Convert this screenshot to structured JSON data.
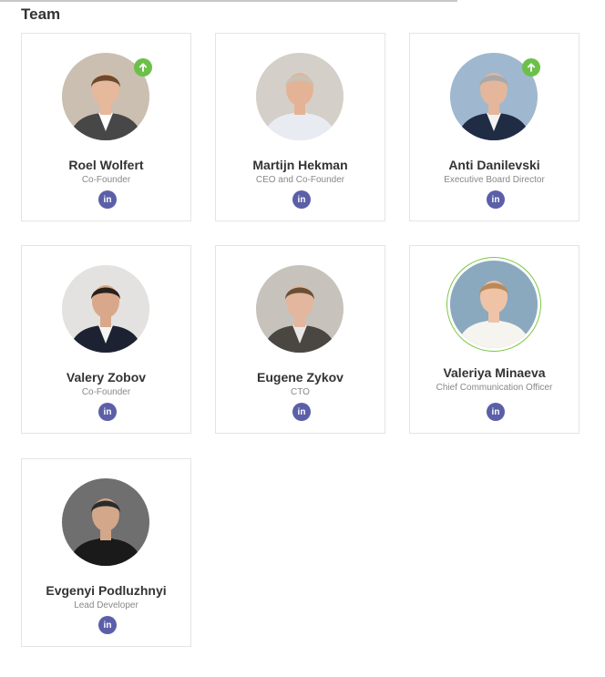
{
  "section": {
    "title": "Team"
  },
  "members": [
    {
      "name": "Roel Wolfert",
      "role": "Co-Founder",
      "badge": true,
      "featured": false,
      "bg": "#cbbfb2",
      "shirt": "#ffffff",
      "jacket": "#474747",
      "hair": "#6b4a30",
      "skin": "#e6b89c"
    },
    {
      "name": "Martijn Hekman",
      "role": "CEO and Co-Founder",
      "badge": false,
      "featured": false,
      "bg": "#d4d0c9",
      "shirt": "#e8ecf2",
      "jacket": "#e8ecf2",
      "hair": "#c9c2b5",
      "skin": "#e4b396"
    },
    {
      "name": "Anti Danilevski",
      "role": "Executive Board Director",
      "badge": true,
      "featured": false,
      "bg": "#9fb8cf",
      "shirt": "#f2f2f2",
      "jacket": "#1f2c44",
      "hair": "#a8a8a8",
      "skin": "#e4b69c"
    },
    {
      "name": "Valery Zobov",
      "role": "Co-Founder",
      "badge": false,
      "featured": false,
      "bg": "#e4e2e0",
      "shirt": "#f4f4f4",
      "jacket": "#1d2233",
      "hair": "#2a211c",
      "skin": "#d9a88a"
    },
    {
      "name": "Eugene Zykov",
      "role": "CTO",
      "badge": false,
      "featured": false,
      "bg": "#c7c3bc",
      "shirt": "#e8e8e8",
      "jacket": "#4a4743",
      "hair": "#6a4f35",
      "skin": "#e2b79e"
    },
    {
      "name": "Valeriya Minaeva",
      "role": "Chief Communication Officer",
      "badge": false,
      "featured": true,
      "bg": "#8aa9bf",
      "shirt": "#f6f4ef",
      "jacket": "#f6f4ef",
      "hair": "#b88a5a",
      "skin": "#efc3a6"
    },
    {
      "name": "Evgenyi Podluzhnyi",
      "role": "Lead Developer",
      "badge": false,
      "featured": false,
      "bg": "#6f6f6f",
      "shirt": "#1a1a1a",
      "jacket": "#1a1a1a",
      "hair": "#2b2b2b",
      "skin": "#d2a78a"
    }
  ],
  "social": {
    "linkedin_label": "in",
    "linkedin_color": "#5b5fa8"
  },
  "colors": {
    "badge": "#6cc04a",
    "featured_ring": "#7ac943",
    "card_border": "#e4e4e4"
  }
}
